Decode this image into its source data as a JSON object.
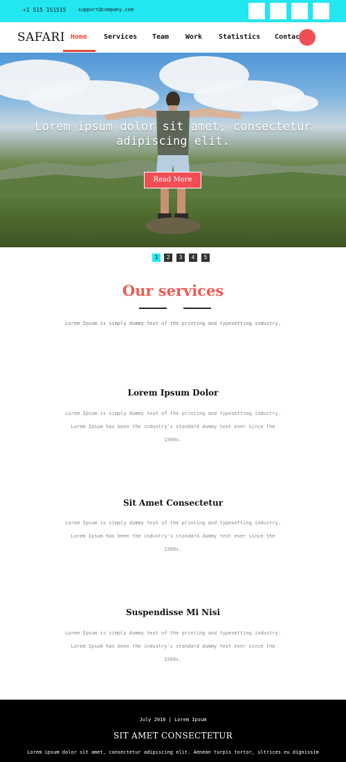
{
  "topbar": {
    "phone": "+1 515 151515",
    "email": "support@company.com",
    "social_icons": [
      "social-icon-1",
      "social-icon-2",
      "social-icon-3",
      "social-icon-4"
    ],
    "background": "#22e6f0"
  },
  "nav": {
    "brand": "SAFARI",
    "items": [
      "Home",
      "Services",
      "Team",
      "Work",
      "Statistics",
      "Contact"
    ],
    "active_item": "Home",
    "accent": "#e8493b"
  },
  "hero": {
    "title": "Lorem ipsum dolor sit amet, consectetur adipiscing elit.",
    "button_label": "Read More",
    "button_color": "#f04d55"
  },
  "slider": {
    "pages": [
      "1",
      "2",
      "3",
      "4",
      "5"
    ],
    "current_page": "1"
  },
  "services": {
    "heading": "Our services",
    "subtitle": "Lorem Ipsum is simply dummy text of the printing and typesetting industry.",
    "heading_color": "#ef5a4f",
    "items": [
      {
        "title": "Lorem Ipsum Dolor",
        "text": "Lorem Ipsum is simply dummy text of the printing and typesetting industry. Lorem Ipsum has been the industry's standard dummy text ever since the 1500s."
      },
      {
        "title": "Sit Amet Consectetur",
        "text": "Lorem Ipsum is simply dummy text of the printing and typesetting industry. Lorem Ipsum has been the industry's standard dummy text ever since the 1500s."
      },
      {
        "title": "Suspendisse Mi Nisi",
        "text": "Lorem Ipsum is simply dummy text of the printing and typesetting industry. Lorem Ipsum has been the industry's standard dummy text ever since the 1500s."
      }
    ]
  },
  "footer": {
    "date_line": "July 2016 | Lorem Ipsum",
    "title": "SIT AMET CONSECTETUR",
    "text": "Lorem ipsum dolor sit amet, consectetur adipiscing elit. Aenean turpis tortor, ultrices eu dignissim"
  }
}
